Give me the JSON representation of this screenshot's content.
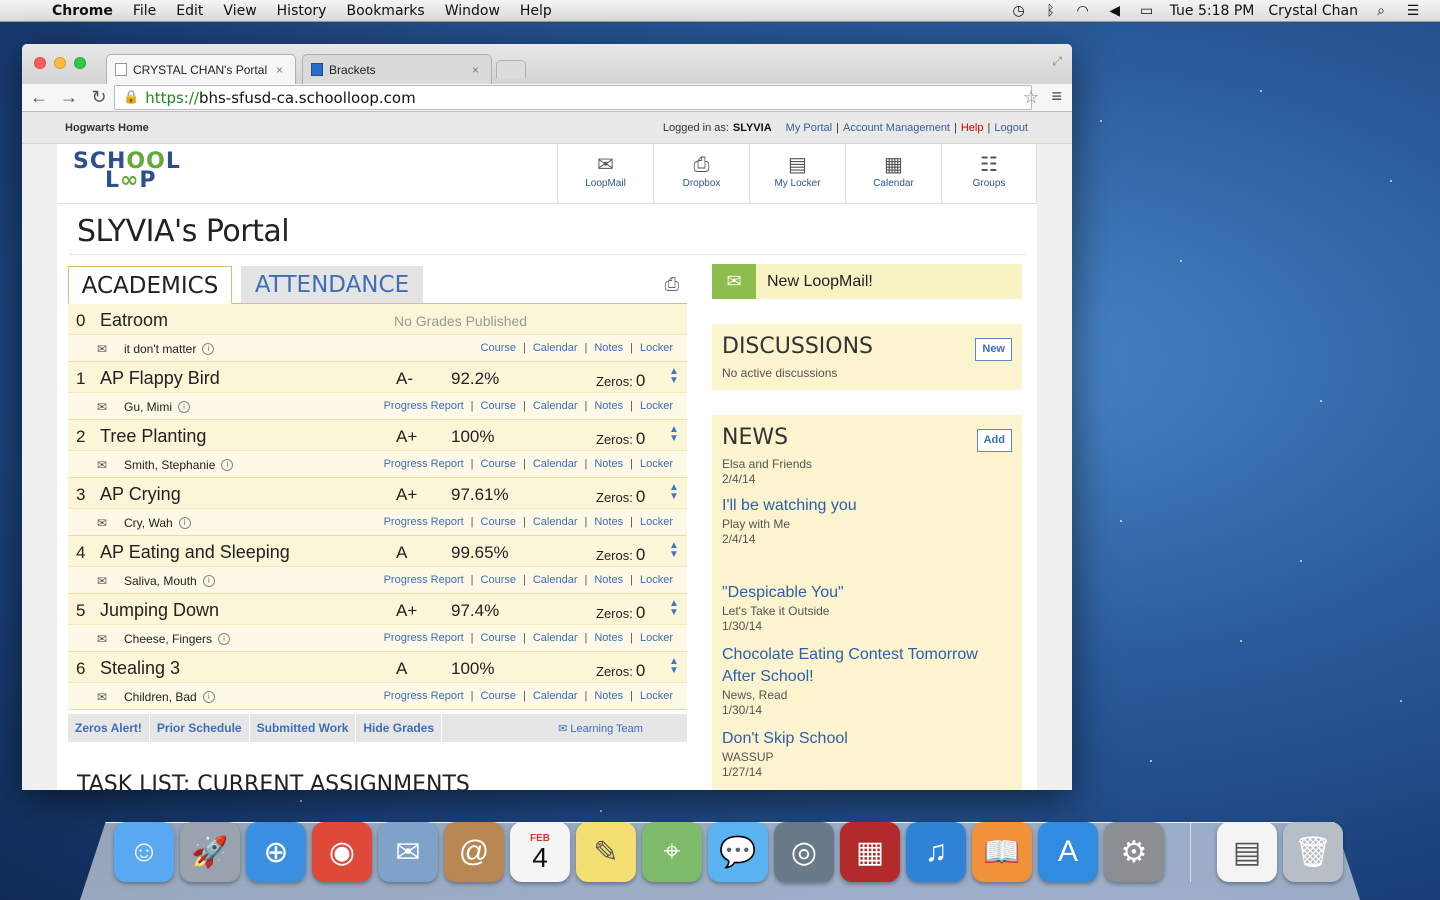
{
  "menubar": {
    "app": "Chrome",
    "items": [
      "File",
      "Edit",
      "View",
      "History",
      "Bookmarks",
      "Window",
      "Help"
    ],
    "clock": "Tue 5:18 PM",
    "user": "Crystal Chan"
  },
  "browser": {
    "tabs": [
      {
        "title": "CRYSTAL CHAN's Portal",
        "close": "×"
      },
      {
        "title": "Brackets",
        "close": "×"
      }
    ],
    "url_scheme": "https://",
    "url_host": "bhs-sfusd-ca.schoolloop.com"
  },
  "site": {
    "home_link": "Hogwarts Home",
    "logged_in_as": "Logged in as:",
    "username": "SLYVIA",
    "my_portal": "My Portal",
    "account_mgmt": "Account Management",
    "help": "Help",
    "logout": "Logout",
    "sep": "|",
    "logo_line1": "SCH",
    "logo_oo": "OO",
    "logo_line1b": "L",
    "logo_line2": "L",
    "logo_line2b": "P",
    "nav": [
      {
        "label": "LoopMail",
        "icon": "✉"
      },
      {
        "label": "Dropbox",
        "icon": "⎙"
      },
      {
        "label": "My Locker",
        "icon": "▤"
      },
      {
        "label": "Calendar",
        "icon": "▦"
      },
      {
        "label": "Groups",
        "icon": "☷"
      }
    ]
  },
  "portal": {
    "title": "SLYVIA's Portal",
    "tabs": {
      "academics": "ACADEMICS",
      "attendance": "ATTENDANCE"
    },
    "no_grades": "No Grades Published",
    "zeros_label": "Zeros:",
    "links": {
      "progress": "Progress Report",
      "course": "Course",
      "calendar": "Calendar",
      "notes": "Notes",
      "locker": "Locker",
      "sep": "|"
    },
    "courses": [
      {
        "period": "0",
        "name": "Eatroom",
        "teacher": "it don't matter"
      },
      {
        "period": "1",
        "name": "AP Flappy Bird",
        "grade": "A-",
        "pct": "92.2%",
        "zeros": "0",
        "teacher": "Gu, Mimi"
      },
      {
        "period": "2",
        "name": "Tree Planting",
        "grade": "A+",
        "pct": "100%",
        "zeros": "0",
        "teacher": "Smith, Stephanie"
      },
      {
        "period": "3",
        "name": "AP Crying",
        "grade": "A+",
        "pct": "97.61%",
        "zeros": "0",
        "teacher": "Cry, Wah"
      },
      {
        "period": "4",
        "name": "AP Eating and Sleeping",
        "grade": "A",
        "pct": "99.65%",
        "zeros": "0",
        "teacher": "Saliva, Mouth"
      },
      {
        "period": "5",
        "name": "Jumping Down",
        "grade": "A+",
        "pct": "97.4%",
        "zeros": "0",
        "teacher": "Cheese, Fingers"
      },
      {
        "period": "6",
        "name": "Stealing 3",
        "grade": "A",
        "pct": "100%",
        "zeros": "0",
        "teacher": "Children, Bad"
      }
    ],
    "bottom_links": [
      "Zeros Alert!",
      "Prior Schedule",
      "Submitted Work",
      "Hide Grades"
    ],
    "learning_team": "Learning Team",
    "task_list": "TASK LIST: CURRENT ASSIGNMENTS"
  },
  "sidebar": {
    "loopmail": "New LoopMail!",
    "discussions": {
      "title": "DISCUSSIONS",
      "button": "New",
      "empty": "No active discussions"
    },
    "news": {
      "title": "NEWS",
      "button": "Add",
      "items": [
        {
          "title": "",
          "sub": "Elsa and Friends",
          "date": "2/4/14"
        },
        {
          "title": "I'll be watching you",
          "sub": "Play with Me",
          "date": "2/4/14"
        },
        {
          "title": "\"Despicable You\"",
          "sub": "Let's Take it Outside",
          "date": "1/30/14"
        },
        {
          "title": "Chocolate Eating Contest Tomorrow After School!",
          "sub": "News, Read",
          "date": "1/30/14"
        },
        {
          "title": "Don't Skip School",
          "sub": "WASSUP",
          "date": "1/27/14"
        }
      ]
    }
  },
  "dock": [
    "finder-icon",
    "launchpad-icon",
    "safari-icon",
    "chrome-icon",
    "mail-icon",
    "contacts-icon",
    "calendar-icon",
    "notes-icon",
    "maps-icon",
    "messages-icon",
    "facetime-icon",
    "photobooth-icon",
    "itunes-icon",
    "ibooks-icon",
    "appstore-icon",
    "preferences-icon",
    "document-icon",
    "trash-icon"
  ],
  "dock_calendar": {
    "month": "FEB",
    "day": "4"
  }
}
